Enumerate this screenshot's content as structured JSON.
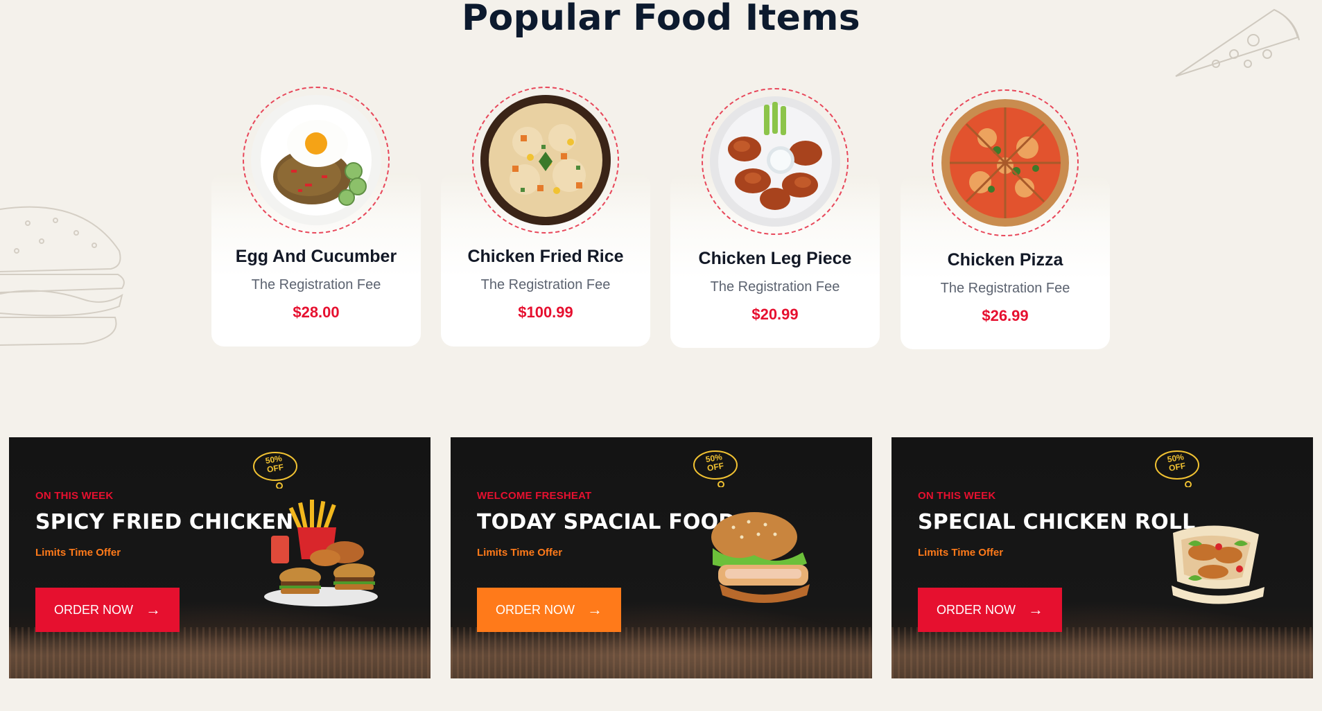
{
  "section": {
    "title": "Popular Food Items"
  },
  "food_items": [
    {
      "name": "Egg And Cucumber",
      "subtitle": "The Registration Fee",
      "price": "$28.00",
      "image": "egg-cucumber-plate"
    },
    {
      "name": "Chicken Fried Rice",
      "subtitle": "The Registration Fee",
      "price": "$100.99",
      "image": "fried-rice-bowl"
    },
    {
      "name": "Chicken Leg Piece",
      "subtitle": "The Registration Fee",
      "price": "$20.99",
      "image": "chicken-wings-plate"
    },
    {
      "name": "Chicken Pizza",
      "subtitle": "The Registration Fee",
      "price": "$26.99",
      "image": "pizza"
    }
  ],
  "banners": [
    {
      "kicker": "ON THIS WEEK",
      "title": "SPICY FRIED CHICKEN",
      "offer": "Limits Time Offer",
      "button": "ORDER NOW",
      "badge_top": "50%",
      "badge_bottom": "OFF",
      "button_color": "#e6102f",
      "image": "fried-chicken-combo"
    },
    {
      "kicker": "WELCOME FRESHEAT",
      "title": "TODAY SPACIAL FOOD",
      "offer": "Limits Time Offer",
      "button": "ORDER NOW",
      "badge_top": "50%",
      "badge_bottom": "OFF",
      "button_color": "#ff7a1a",
      "image": "burger"
    },
    {
      "kicker": "ON THIS WEEK",
      "title": "SPECIAL CHICKEN ROLL",
      "offer": "Limits Time Offer",
      "button": "ORDER NOW",
      "badge_top": "50%",
      "badge_bottom": "OFF",
      "button_color": "#e6102f",
      "image": "chicken-roll"
    }
  ],
  "colors": {
    "accent_red": "#e6102f",
    "accent_orange": "#ff7a1a",
    "heading": "#0c1a2e",
    "background": "#f4f1eb"
  },
  "icons": {
    "arrow": "arrow-right-icon",
    "badge": "discount-badge-icon",
    "deco_left": "burger-sketch-icon",
    "deco_right": "pizza-slice-sketch-icon"
  }
}
